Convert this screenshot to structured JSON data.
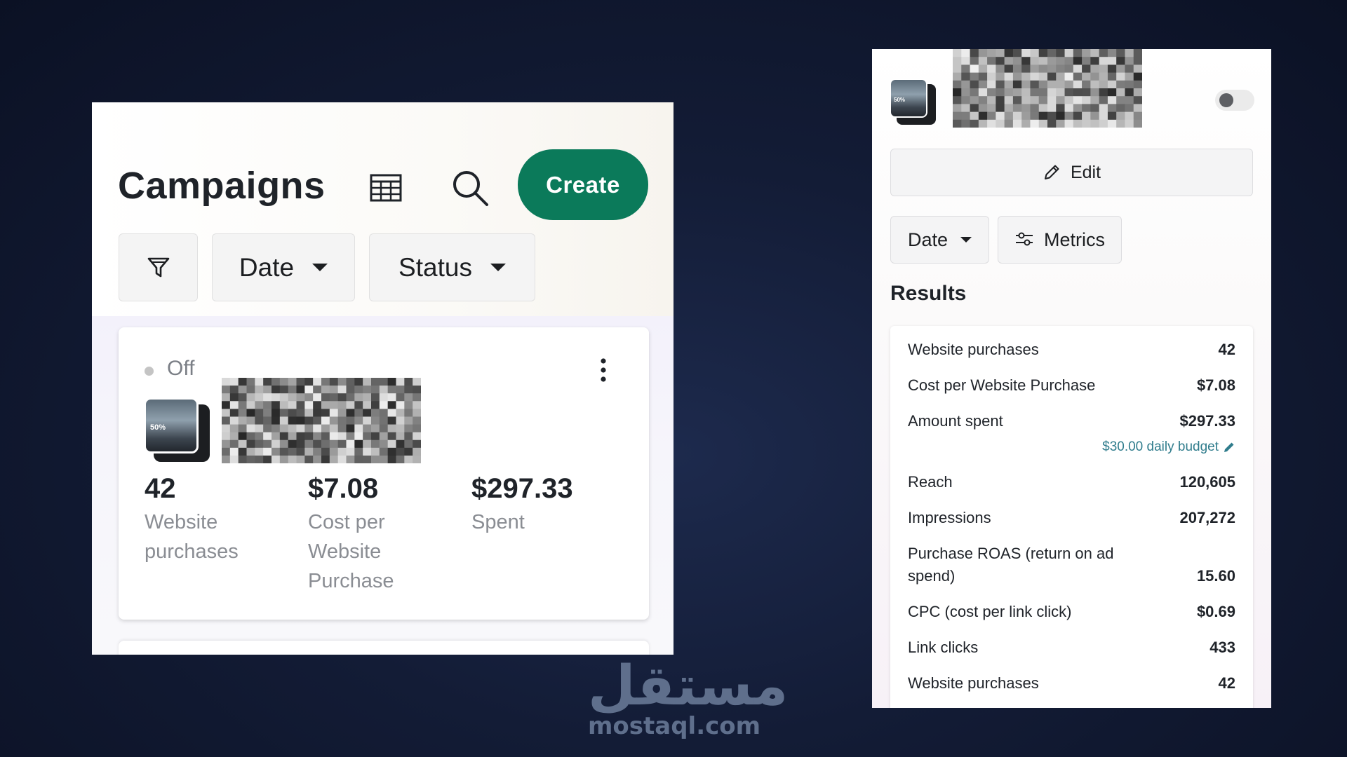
{
  "campaigns_panel": {
    "title": "Campaigns",
    "create_label": "Create",
    "filters": {
      "date_label": "Date",
      "status_label": "Status"
    },
    "campaign": {
      "status": "Off",
      "thumbnail_badge": "50%",
      "metrics": [
        {
          "value": "42",
          "label": "Website purchases"
        },
        {
          "value": "$7.08",
          "label": "Cost per Website Purchase"
        },
        {
          "value": "$297.33",
          "label": "Spent"
        }
      ]
    }
  },
  "details_panel": {
    "thumbnail_badge": "50%",
    "edit_label": "Edit",
    "date_label": "Date",
    "metrics_label": "Metrics",
    "results_title": "Results",
    "results": [
      {
        "label": "Website purchases",
        "value": "42"
      },
      {
        "label": "Cost per Website Purchase",
        "value": "$7.08"
      },
      {
        "label": "Amount spent",
        "value": "$297.33"
      },
      {
        "label": "Reach",
        "value": "120,605"
      },
      {
        "label": "Impressions",
        "value": "207,272"
      },
      {
        "label": "Purchase ROAS (return on ad spend)",
        "value": "15.60"
      },
      {
        "label": "CPC (cost per link click)",
        "value": "$0.69"
      },
      {
        "label": "Link clicks",
        "value": "433"
      },
      {
        "label": "Website purchases",
        "value": "42"
      }
    ],
    "daily_budget": "$30.00 daily budget",
    "toggle_on": false
  },
  "watermark": {
    "arabic": "مستقل",
    "latin": "mostaql.com"
  },
  "colors": {
    "create_green": "#0b7a5a",
    "budget_link": "#2f7c8c",
    "background": "#131c36"
  }
}
